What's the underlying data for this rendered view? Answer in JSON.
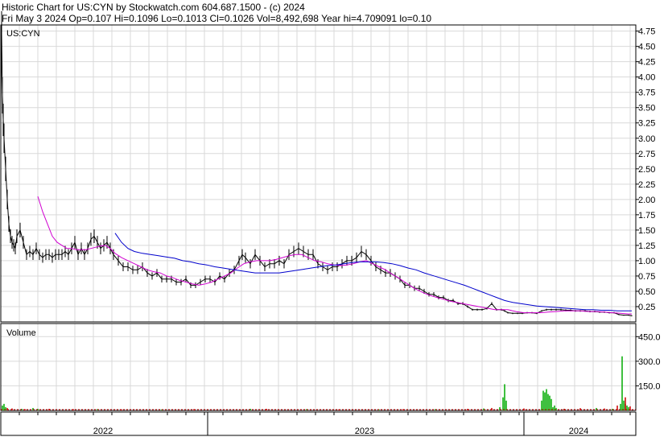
{
  "header": {
    "line1": "Historic Chart for US:CYN by Stockwatch.com 604.687.1500 - (c) 2024",
    "line2": "Fri May  3 2024   Op=0.107   Hi=0.1096   Lo=0.1013   Cl=0.1026   Vol=8,492,698   Year hi=4.709091   lo=0.10"
  },
  "chart_data": [
    {
      "type": "line",
      "title": "US:CYN",
      "price_ticks": [
        "4.75",
        "4.50",
        "4.25",
        "4.00",
        "3.75",
        "3.50",
        "3.25",
        "3.00",
        "2.75",
        "2.50",
        "2.25",
        "2.00",
        "1.75",
        "1.50",
        "1.25",
        "1.00",
        "0.75",
        "0.50",
        "0.25"
      ],
      "ylim": [
        0,
        4.85
      ],
      "x_labels": [
        "2022",
        "2023",
        "2024"
      ],
      "grid": true,
      "series": [
        {
          "color": "#000000",
          "x": [
            0,
            1,
            2,
            3,
            4,
            6,
            8,
            10,
            12,
            14,
            16,
            18,
            20,
            24,
            28,
            32,
            36,
            40,
            44,
            48,
            52,
            56,
            60,
            64,
            68,
            72,
            76,
            80,
            84,
            88,
            92,
            96,
            100,
            104,
            108,
            112,
            116,
            120,
            124,
            128,
            132,
            136,
            140,
            146,
            152,
            158,
            164,
            170,
            176,
            182,
            188,
            194,
            200,
            206,
            212,
            218,
            224,
            230,
            236,
            242,
            248,
            254,
            260,
            266,
            272,
            278,
            284,
            290,
            296,
            300,
            304,
            310,
            316,
            322,
            328,
            334,
            340,
            346,
            352,
            358,
            364,
            370,
            376,
            382,
            388,
            394,
            400,
            406,
            412,
            418,
            424,
            430,
            436,
            442,
            448,
            454,
            460,
            466,
            472,
            478,
            484,
            490,
            496,
            502,
            508,
            514,
            520,
            526,
            532,
            538,
            544,
            550,
            556,
            562,
            568,
            574,
            580,
            586,
            592,
            598,
            604,
            610,
            616,
            622,
            626,
            630,
            636,
            642,
            648,
            654,
            660,
            666,
            672,
            678,
            684,
            690,
            696,
            702,
            708,
            714,
            720,
            726,
            732,
            738,
            744,
            750,
            756,
            762,
            768,
            774,
            780,
            784
          ],
          "values": [
            3.5,
            4.7,
            3.7,
            3.3,
            3.0,
            2.5,
            2.0,
            1.6,
            1.4,
            1.3,
            1.25,
            1.2,
            1.4,
            1.5,
            1.3,
            1.1,
            1.15,
            1.1,
            1.2,
            1.1,
            1.05,
            1.1,
            1.1,
            1.05,
            1.1,
            1.1,
            1.1,
            1.15,
            1.1,
            1.2,
            1.3,
            1.1,
            1.2,
            1.1,
            1.2,
            1.35,
            1.4,
            1.3,
            1.2,
            1.25,
            1.3,
            1.2,
            1.1,
            1.0,
            0.9,
            0.9,
            0.85,
            0.85,
            0.9,
            0.8,
            0.75,
            0.8,
            0.7,
            0.7,
            0.7,
            0.65,
            0.65,
            0.7,
            0.6,
            0.6,
            0.65,
            0.7,
            0.7,
            0.65,
            0.75,
            0.7,
            0.8,
            0.85,
            1.0,
            1.1,
            1.05,
            0.95,
            1.1,
            1.0,
            0.9,
            0.95,
            0.95,
            1.0,
            0.95,
            1.1,
            1.15,
            1.2,
            1.15,
            1.1,
            1.1,
            0.95,
            0.9,
            0.85,
            0.9,
            0.9,
            0.95,
            1.0,
            1.0,
            1.05,
            1.15,
            1.1,
            1.0,
            0.9,
            0.85,
            0.8,
            0.8,
            0.75,
            0.7,
            0.6,
            0.6,
            0.55,
            0.55,
            0.5,
            0.45,
            0.45,
            0.4,
            0.4,
            0.35,
            0.35,
            0.3,
            0.3,
            0.25,
            0.2,
            0.2,
            0.2,
            0.22,
            0.3,
            0.2,
            0.2,
            0.18,
            0.15,
            0.14,
            0.14,
            0.14,
            0.15,
            0.15,
            0.14,
            0.18,
            0.2,
            0.2,
            0.2,
            0.2,
            0.19,
            0.19,
            0.18,
            0.18,
            0.18,
            0.17,
            0.17,
            0.16,
            0.16,
            0.15,
            0.15,
            0.12,
            0.11,
            0.11,
            0.1
          ]
        },
        {
          "color": "#d000d0",
          "x": [
            46,
            52,
            58,
            64,
            70,
            76,
            82,
            88,
            94,
            100,
            106,
            112,
            118,
            124,
            130,
            136,
            142,
            150,
            158,
            166,
            174,
            182,
            190,
            198,
            206,
            214,
            222,
            230,
            238,
            246,
            254,
            262,
            270,
            278,
            286,
            294,
            302,
            310,
            318,
            326,
            334,
            342,
            350,
            358,
            366,
            374,
            382,
            390,
            398,
            406,
            414,
            422,
            430,
            438,
            446,
            454,
            462,
            470,
            478,
            486,
            494,
            502,
            510,
            518,
            526,
            534,
            542,
            550,
            558,
            566,
            574,
            582,
            590,
            598,
            606,
            614,
            622,
            630,
            640,
            650,
            660,
            670,
            680,
            690,
            700,
            710,
            720,
            730,
            740,
            750,
            760,
            770,
            780,
            784
          ],
          "values": [
            2.05,
            1.8,
            1.6,
            1.4,
            1.3,
            1.25,
            1.2,
            1.2,
            1.18,
            1.18,
            1.18,
            1.2,
            1.22,
            1.24,
            1.25,
            1.2,
            1.12,
            1.05,
            1.0,
            0.95,
            0.9,
            0.85,
            0.82,
            0.8,
            0.75,
            0.72,
            0.68,
            0.65,
            0.62,
            0.6,
            0.62,
            0.65,
            0.7,
            0.75,
            0.8,
            0.88,
            0.95,
            0.98,
            1.0,
            1.0,
            1.0,
            1.02,
            1.05,
            1.08,
            1.1,
            1.1,
            1.05,
            1.0,
            0.98,
            0.95,
            0.93,
            0.92,
            0.93,
            0.95,
            0.98,
            1.0,
            0.95,
            0.9,
            0.85,
            0.78,
            0.72,
            0.65,
            0.58,
            0.52,
            0.47,
            0.43,
            0.4,
            0.37,
            0.34,
            0.32,
            0.3,
            0.28,
            0.26,
            0.24,
            0.22,
            0.2,
            0.2,
            0.2,
            0.17,
            0.15,
            0.15,
            0.15,
            0.16,
            0.17,
            0.18,
            0.18,
            0.18,
            0.17,
            0.17,
            0.16,
            0.15,
            0.14,
            0.13,
            0.13
          ]
        },
        {
          "color": "#0000cc",
          "x": [
            142,
            150,
            158,
            166,
            176,
            186,
            196,
            206,
            216,
            226,
            236,
            246,
            256,
            266,
            276,
            286,
            296,
            306,
            316,
            326,
            336,
            346,
            356,
            366,
            376,
            386,
            396,
            406,
            416,
            426,
            436,
            446,
            456,
            466,
            476,
            486,
            496,
            506,
            516,
            526,
            536,
            546,
            556,
            566,
            576,
            586,
            596,
            606,
            616,
            626,
            636,
            646,
            656,
            666,
            676,
            686,
            696,
            706,
            716,
            726,
            736,
            746,
            756,
            766,
            776,
            784
          ],
          "values": [
            1.45,
            1.3,
            1.2,
            1.15,
            1.12,
            1.1,
            1.08,
            1.06,
            1.04,
            1.0,
            0.98,
            0.95,
            0.93,
            0.9,
            0.88,
            0.86,
            0.84,
            0.82,
            0.8,
            0.8,
            0.8,
            0.8,
            0.82,
            0.84,
            0.86,
            0.88,
            0.9,
            0.92,
            0.93,
            0.95,
            0.97,
            0.98,
            0.98,
            0.98,
            0.97,
            0.95,
            0.92,
            0.88,
            0.85,
            0.8,
            0.76,
            0.72,
            0.68,
            0.64,
            0.6,
            0.55,
            0.5,
            0.45,
            0.4,
            0.35,
            0.32,
            0.3,
            0.28,
            0.26,
            0.25,
            0.24,
            0.23,
            0.22,
            0.21,
            0.2,
            0.2,
            0.19,
            0.19,
            0.18,
            0.18,
            0.18
          ]
        }
      ]
    },
    {
      "type": "bar",
      "title": "Volume",
      "volume_ticks": [
        "450.0",
        "300.0",
        "150.0"
      ],
      "ylim": [
        0,
        530
      ],
      "series": [
        {
          "color": "#00aa00",
          "x": [
            2,
            4,
            6,
            26,
            40,
            46,
            120,
            200,
            310,
            380,
            470,
            540,
            600,
            620,
            624,
            626,
            628,
            672,
            674,
            676,
            678,
            680,
            682,
            684,
            686,
            688,
            690,
            700,
            740,
            760,
            770,
            772,
            774,
            776,
            778,
            780
          ],
          "values": [
            30,
            40,
            20,
            10,
            15,
            10,
            8,
            6,
            10,
            8,
            6,
            8,
            12,
            20,
            80,
            160,
            60,
            60,
            120,
            110,
            130,
            100,
            90,
            70,
            20,
            30,
            15,
            10,
            15,
            10,
            40,
            330,
            60,
            40,
            30,
            20
          ]
        },
        {
          "color": "#cc0000",
          "x": [
            8,
            14,
            30,
            60,
            90,
            150,
            240,
            330,
            420,
            500,
            580,
            610,
            650,
            700,
            720,
            750,
            766,
            776,
            782
          ],
          "values": [
            15,
            12,
            8,
            10,
            8,
            6,
            8,
            10,
            6,
            8,
            10,
            15,
            12,
            10,
            14,
            12,
            30,
            80,
            25
          ]
        }
      ]
    }
  ]
}
